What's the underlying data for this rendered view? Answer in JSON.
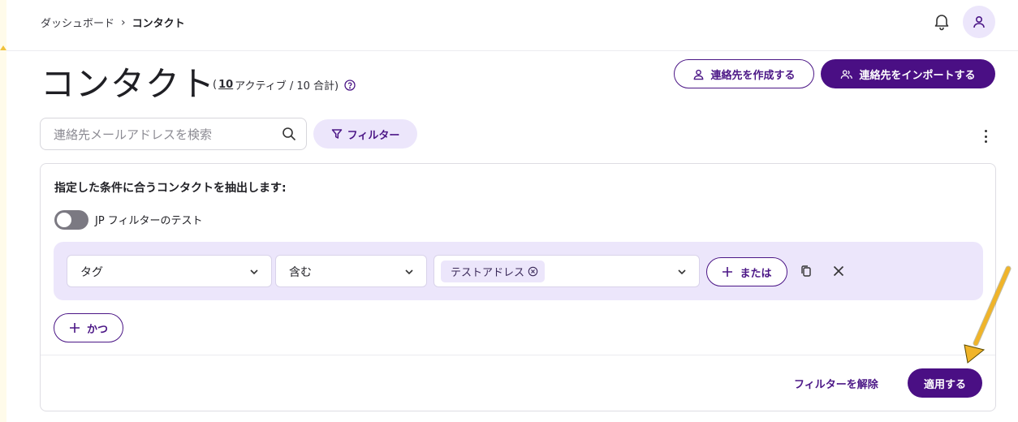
{
  "breadcrumb": {
    "parent": "ダッシュボード",
    "separator": "›",
    "current": "コンタクト"
  },
  "header": {
    "bell_icon": "bell-icon",
    "avatar_icon": "user-icon"
  },
  "page": {
    "title": "コンタクト",
    "counts": {
      "open": "(",
      "active_count": "10",
      "active_label": " アクティブ / 10 合計)"
    }
  },
  "actions": {
    "create_label": "連絡先を作成する",
    "import_label": "連絡先をインポートする"
  },
  "search": {
    "placeholder": "連絡先メールアドレスを検索",
    "value": ""
  },
  "filter_button": {
    "label": "フィルター"
  },
  "filter_panel": {
    "heading": "指定した条件に合うコンタクトを抽出します:",
    "toggle_label": "JP フィルターのテスト",
    "toggle_on": false,
    "condition": {
      "field": "タグ",
      "operator": "含む",
      "value_chip": "テストアドレス",
      "or_label": "または"
    },
    "and_label": "かつ",
    "clear_label": "フィルターを解除",
    "apply_label": "適用する"
  },
  "colors": {
    "brand": "#4a0f84",
    "brand_light": "#ece6fb",
    "annotation_arrow": "#f0b429"
  }
}
